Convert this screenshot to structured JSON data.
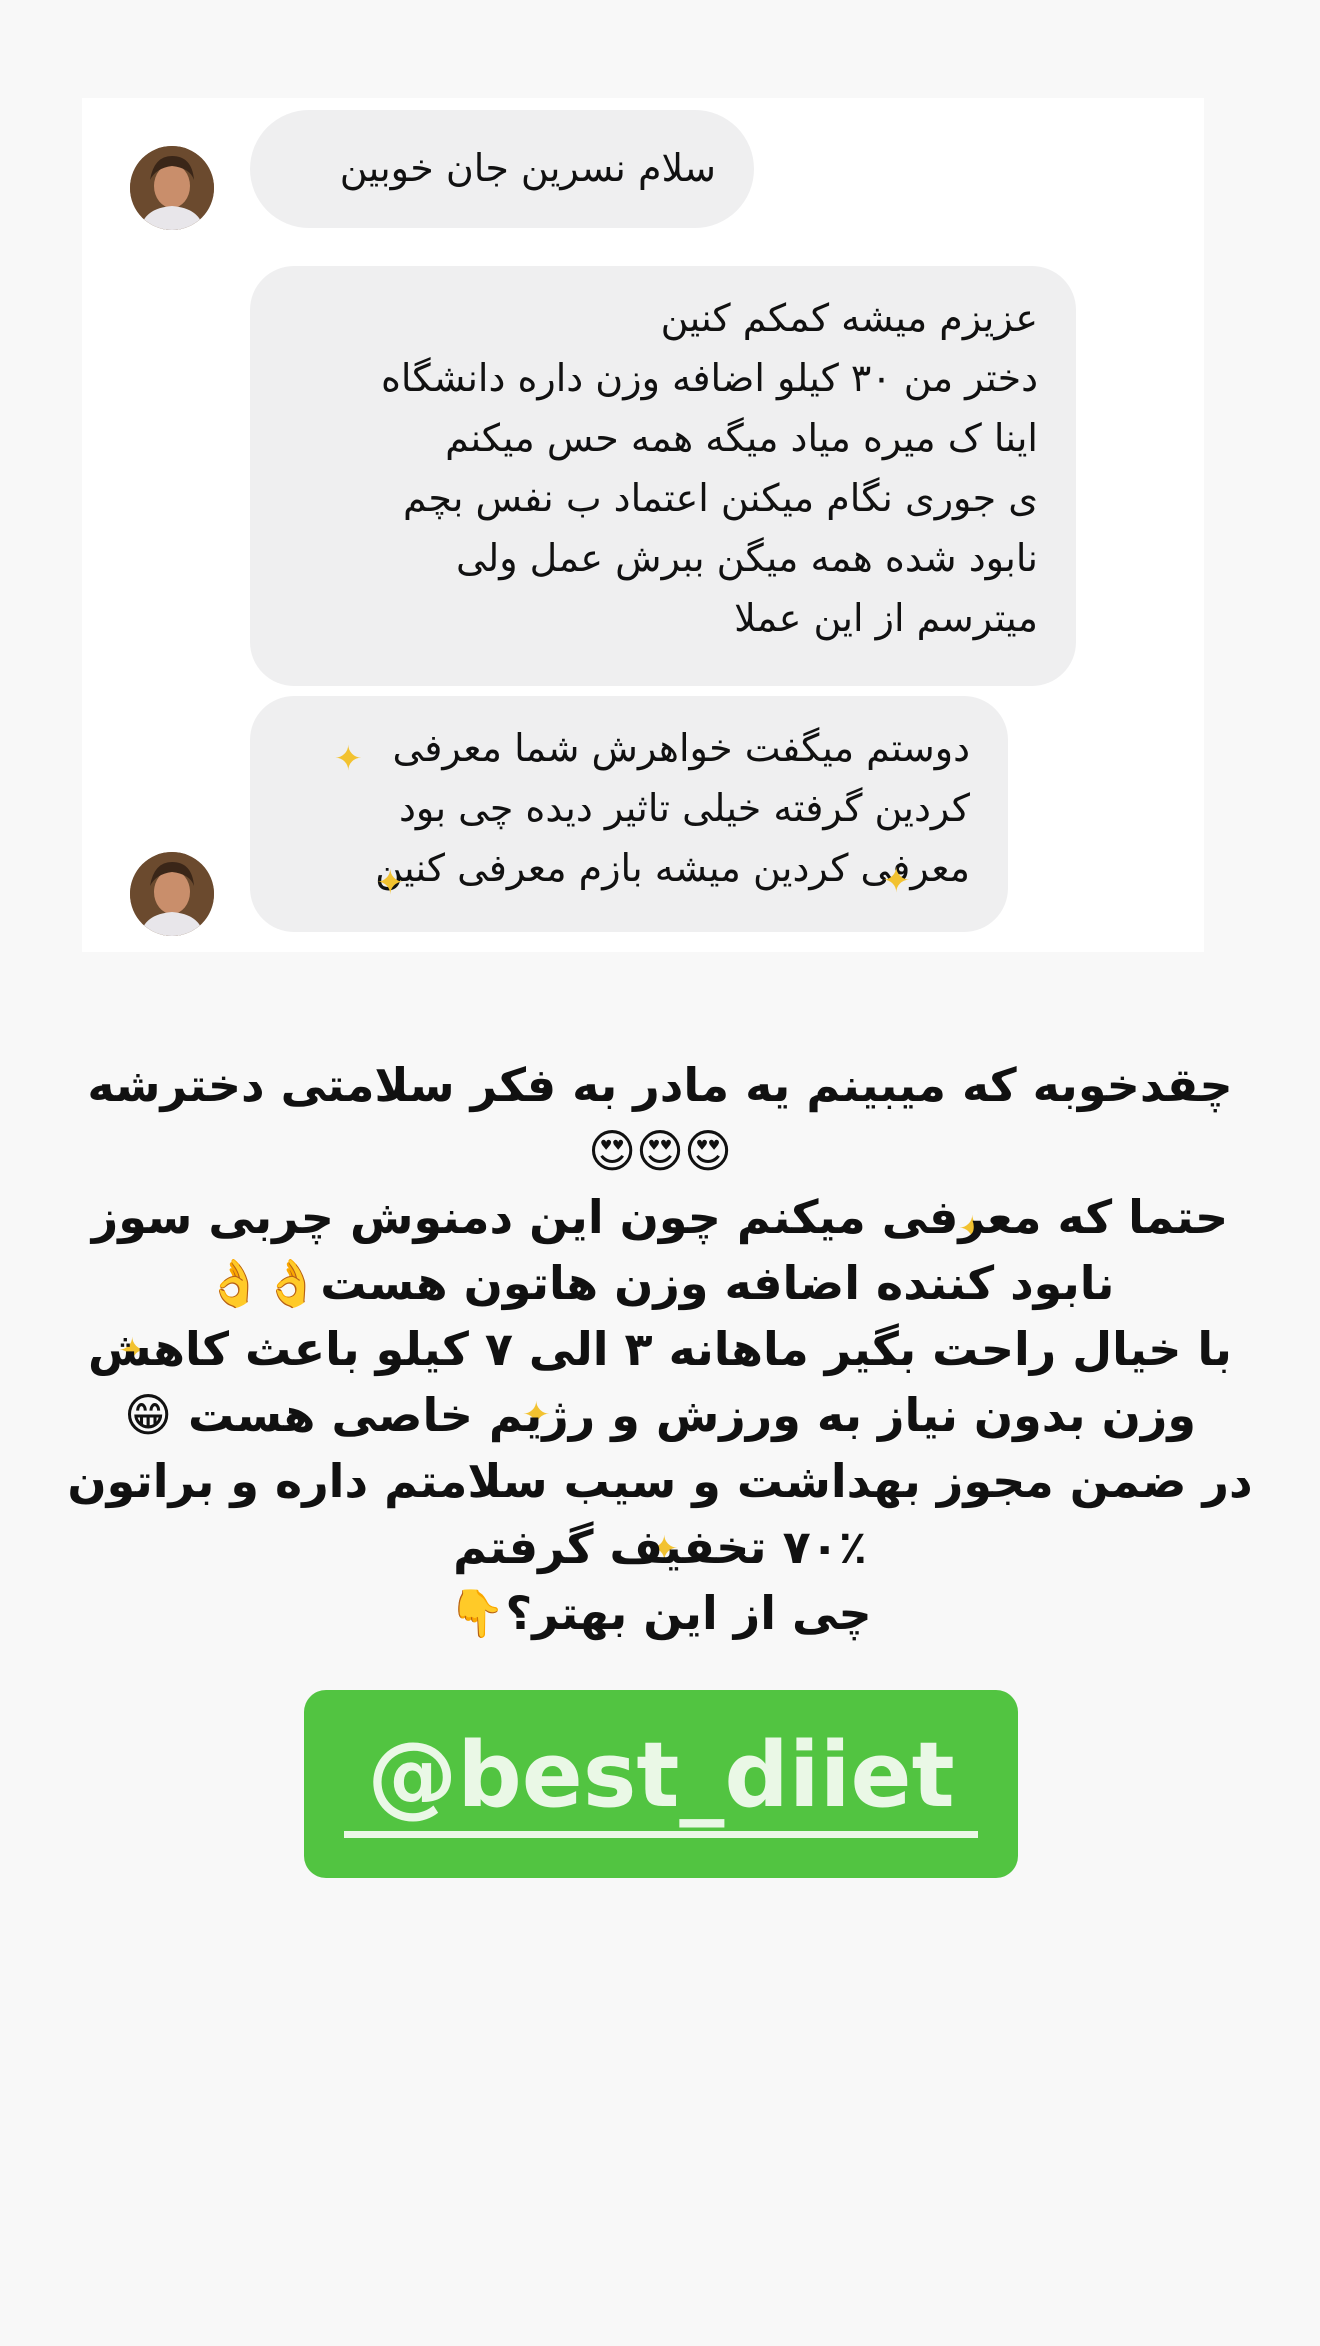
{
  "chat": {
    "messages": [
      {
        "lines": [
          "سلام نسرین جان خوبین"
        ]
      },
      {
        "lines": [
          "عزیزم میشه کمکم کنین",
          "دختر من ۳۰ کیلو اضافه وزن داره دانشگاه",
          "اینا ک میره میاد میگه همه حس میکنم",
          "ی جوری نگام میکنن اعتماد ب نفس بچم",
          "نابود شده همه میگن ببرش عمل ولی",
          "میترسم از این عملا"
        ]
      },
      {
        "lines": [
          "دوستم میگفت خواهرش شما معرفی",
          "کردین گرفته خیلی تاثیر دیده چی بود",
          "معرفی کردین میشه بازم معرفی کنین"
        ]
      }
    ]
  },
  "caption": {
    "lines": [
      "چقدخوبه که میبینم یه مادر به فکر سلامتی دخترشه",
      "😍😍😍",
      "حتما که معرفی میکنم چون این دمنوش چربی سوز",
      "نابود کننده اضافه وزن هاتون هست👌👌",
      "با خیال راحت بگیر ماهانه ۳ الی ۷ کیلو باعث کاهش",
      "وزن بدون نیاز به ورزش و رژیم خاصی هست 😁",
      "در ضمن مجوز بهداشت و سیب سلامتم داره و براتون",
      "۷۰٪ تخفیف گرفتم",
      "چی از این بهتر؟👇"
    ]
  },
  "mention": {
    "handle": "@best_diiet"
  },
  "colors": {
    "mention_bg": "#52c441",
    "mention_text": "#eaf8e6",
    "bubble_bg": "#efeff0",
    "page_bg": "#f8f8f8"
  },
  "icons": [
    "avatar-photo",
    "sparkle-sticker"
  ]
}
